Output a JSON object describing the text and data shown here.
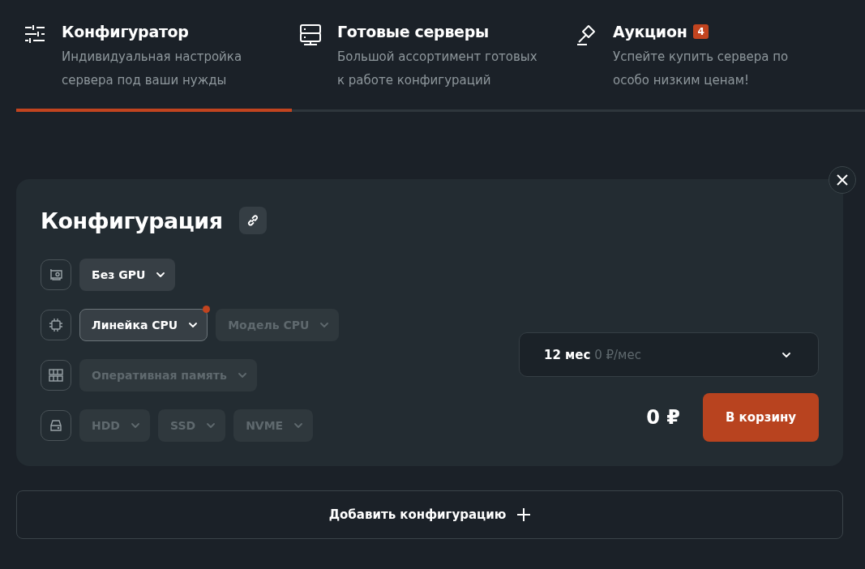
{
  "tabs": [
    {
      "kind": "sliders",
      "title": "Конфигуратор",
      "description": "Индивидуальная настройка сервера под ваши нужды",
      "selected": true
    },
    {
      "kind": "server",
      "title": "Готовые серверы",
      "description": "Большой ассортимент готовых к работе конфигураций",
      "selected": false
    },
    {
      "kind": "gavel",
      "title": "Аукцион",
      "badge": "4",
      "description": "Успейте купить сервера по особо низким ценам!",
      "selected": false
    }
  ],
  "configuration": {
    "title": "Конфигурация",
    "rows": [
      {
        "kind": "gpu",
        "selects": [
          {
            "label": "Без GPU",
            "disabled": false,
            "focused": false,
            "dot": false
          }
        ]
      },
      {
        "kind": "cpu",
        "selects": [
          {
            "label": "Линейка CPU",
            "disabled": false,
            "focused": true,
            "dot": true
          },
          {
            "label": "Модель CPU",
            "disabled": true,
            "focused": false,
            "dot": false
          }
        ]
      },
      {
        "kind": "ram",
        "selects": [
          {
            "label": "Оперативная память",
            "disabled": true,
            "focused": false,
            "dot": false
          }
        ]
      },
      {
        "kind": "disk",
        "selects": [
          {
            "label": "HDD",
            "disabled": true,
            "focused": false,
            "dot": false
          },
          {
            "label": "SSD",
            "disabled": true,
            "focused": false,
            "dot": false
          },
          {
            "label": "NVME",
            "disabled": true,
            "focused": false,
            "dot": false
          }
        ]
      }
    ],
    "period": {
      "term": "12 мес",
      "price": "0 ₽/мес"
    },
    "total": "0 ₽",
    "cart_button": "В корзину"
  },
  "add_button": "Добавить конфигурацию"
}
